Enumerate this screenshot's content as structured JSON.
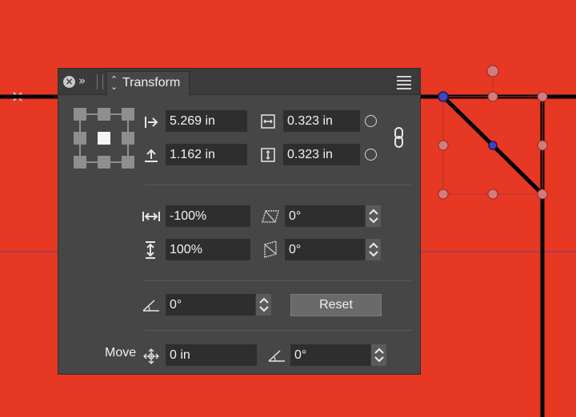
{
  "colors": {
    "canvas_background": "#e63823",
    "panel_background": "#464646",
    "field_background": "#2e2e2e",
    "selection_handle": "#d87878",
    "stroke": "#000000"
  },
  "panel": {
    "tab_label": "Transform",
    "close_icon": "close-icon",
    "collapse_icon": "double-chevron-right-icon",
    "menu_icon": "hamburger-menu-icon"
  },
  "position": {
    "x_value": "5.269 in",
    "y_value": "1.162 in",
    "width_value": "0.323 in",
    "height_value": "0.323 in"
  },
  "scale": {
    "horizontal_value": "-100%",
    "vertical_value": "100%",
    "shear_h_value": "0°",
    "shear_v_value": "0°"
  },
  "rotation": {
    "angle_value": "0°",
    "reset_label": "Reset"
  },
  "move": {
    "label": "Move",
    "distance_value": "0 in",
    "angle_value": "0°"
  }
}
